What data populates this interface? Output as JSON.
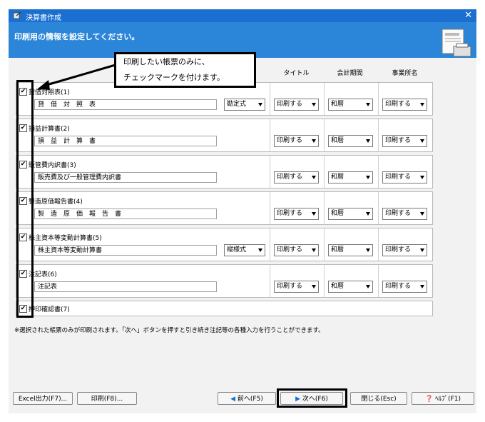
{
  "window": {
    "title": "決算書作成",
    "banner_text": "印刷用の情報を設定してください。"
  },
  "columns": [
    "タイトル",
    "会計期間",
    "事業所名"
  ],
  "rows": [
    {
      "label": "貸借対照表(1)",
      "text": "貸　借　対　照　表",
      "format": "勘定式",
      "title": "印刷する",
      "period": "和暦",
      "office": "印刷する"
    },
    {
      "label": "損益計算書(2)",
      "text": "損　益　計　算　書",
      "title": "印刷する",
      "period": "和暦",
      "office": "印刷する"
    },
    {
      "label": "販管費内訳書(3)",
      "text": "販売費及び一般管理費内訳書",
      "title": "印刷する",
      "period": "和暦",
      "office": "印刷する"
    },
    {
      "label": "製造原価報告書(4)",
      "text": "製　造　原　価　報　告　書",
      "title": "印刷する",
      "period": "和暦",
      "office": "印刷する"
    },
    {
      "label": "株主資本等変動計算書(5)",
      "text": "株主資本等変動計算書",
      "format": "縦様式",
      "title": "印刷する",
      "period": "和暦",
      "office": "印刷する"
    },
    {
      "label": "注記表(6)",
      "text": "注記表",
      "title": "印刷する",
      "period": "和暦",
      "office": "印刷する"
    },
    {
      "label": "押印確認書(7)"
    }
  ],
  "note": "※選択された帳票のみが印刷されます。「次へ」ボタンを押すと引き続き注記等の各種入力を行うことができます。",
  "buttons": {
    "excel": "Excel出力(F7)...",
    "print": "印刷(F8)...",
    "prev": "前へ(F5)",
    "next": "次へ(F6)",
    "close": "閉じる(Esc)",
    "help": "ﾍﾙﾌﾟ(F1)"
  },
  "callout": {
    "line1": "印刷したい帳票のみに、",
    "line2": "チェックマークを付けます。"
  },
  "check_mark": "✔",
  "colors": {
    "titlebar": "#1a6fd0",
    "banner": "#2b86d9"
  }
}
